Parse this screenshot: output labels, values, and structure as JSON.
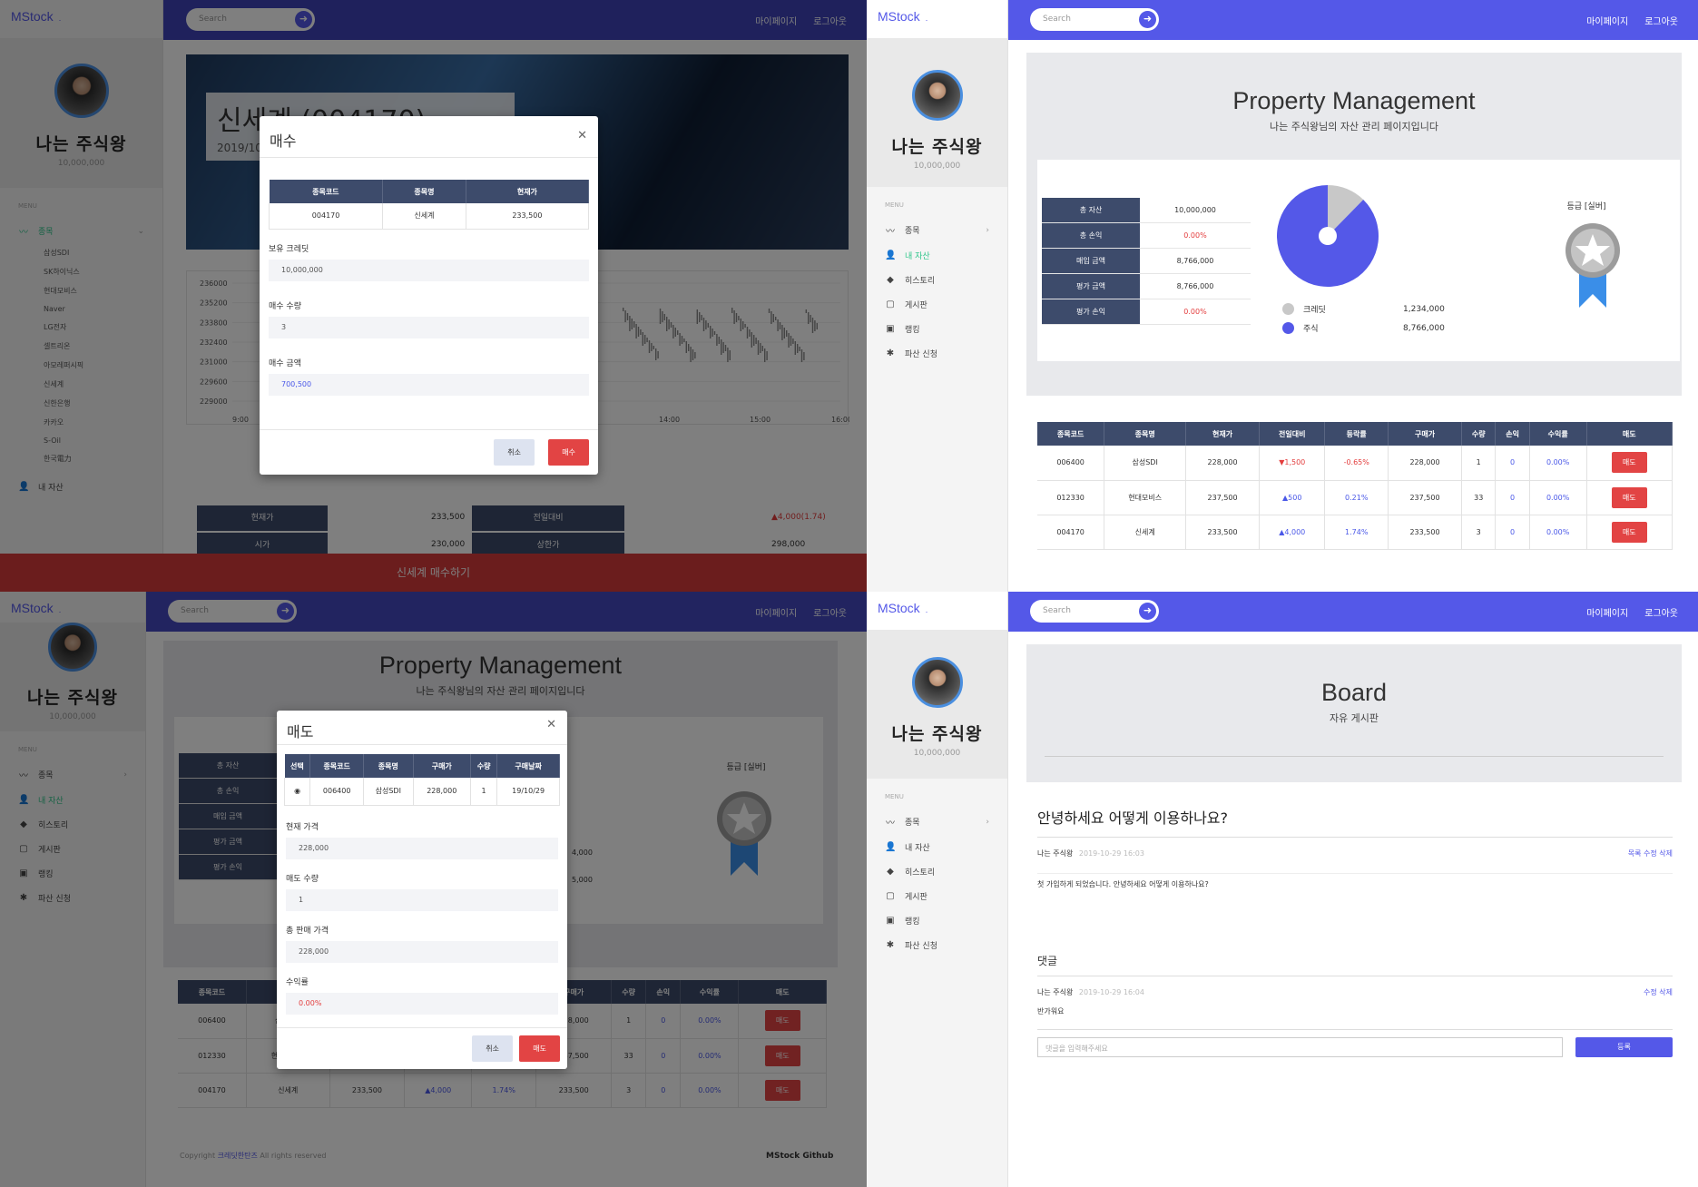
{
  "app": {
    "logo": "MStock",
    "logo_dot": ".",
    "search_placeholder": "Search",
    "nav_mypage": "마이페이지",
    "nav_logout": "로그아웃"
  },
  "profile": {
    "name": "나는 주식왕",
    "balance": "10,000,000"
  },
  "menu": {
    "title": "MENU",
    "items": [
      {
        "label": "종목",
        "icon": "chart-line-icon"
      },
      {
        "label": "내 자산",
        "icon": "user-icon"
      },
      {
        "label": "히스토리",
        "icon": "layers-icon"
      },
      {
        "label": "게시판",
        "icon": "board-icon"
      },
      {
        "label": "랭킹",
        "icon": "book-icon"
      },
      {
        "label": "파산 신청",
        "icon": "asterisk-icon"
      }
    ]
  },
  "stock_list": [
    "삼성SDI",
    "SK하이닉스",
    "현대모비스",
    "Naver",
    "LG전자",
    "셀트리온",
    "아모레퍼시픽",
    "신세계",
    "신한은행",
    "카카오",
    "S-Oil",
    "한국電力"
  ],
  "q1": {
    "banner_title": "신세계 (004170)",
    "banner_date": "2019/10",
    "y_ticks": [
      "236000",
      "235200",
      "233800",
      "232400",
      "231000",
      "229600",
      "229000"
    ],
    "x_ticks": [
      "9:00",
      "14:00",
      "15:00",
      "16:00"
    ],
    "info": [
      {
        "k": "현재가",
        "v": "233,500"
      },
      {
        "k": "전일대비",
        "v": "▲4,000(1.74)"
      },
      {
        "k": "시가",
        "v": "230,000"
      },
      {
        "k": "상한가",
        "v": "298,000"
      }
    ],
    "buy_bar": "신세계 매수하기",
    "modal": {
      "title": "매수",
      "headers": [
        "종목코드",
        "종목명",
        "현재가"
      ],
      "row": [
        "004170",
        "신세계",
        "233,500"
      ],
      "credit_label": "보유 크레딧",
      "credit_value": "10,000,000",
      "qty_label": "매수 수량",
      "qty_value": "3",
      "amount_label": "매수 금액",
      "amount_value": "700,500",
      "cancel": "취소",
      "confirm": "매수"
    }
  },
  "property": {
    "title": "Property Management",
    "subtitle": "나는 주식왕님의 자산 관리 페이지입니다",
    "summary": [
      {
        "k": "총 자산",
        "v": "10,000,000"
      },
      {
        "k": "총 손익",
        "v": "0.00%"
      },
      {
        "k": "매입 금액",
        "v": "8,766,000"
      },
      {
        "k": "평가 금액",
        "v": "8,766,000"
      },
      {
        "k": "평가 손익",
        "v": "0.00%"
      }
    ],
    "grade_label": "등급 [실버]"
  },
  "chart_data": {
    "type": "pie",
    "categories": [
      "크레딧",
      "주식"
    ],
    "values": [
      1234000,
      8766000
    ],
    "labels": [
      "1,234,000",
      "8,766,000"
    ],
    "colors": [
      "#c8c8c8",
      "#5458e8"
    ]
  },
  "holdings": {
    "headers": [
      "종목코드",
      "종목명",
      "현재가",
      "전일대비",
      "등락률",
      "구매가",
      "수량",
      "손익",
      "수익률",
      "매도"
    ],
    "rows": [
      {
        "code": "006400",
        "name": "삼성SDI",
        "price": "228,000",
        "change": "▼1,500",
        "rate": "-0.65%",
        "buy": "228,000",
        "qty": "1",
        "pl": "0",
        "ret": "0.00%",
        "btn": "매도"
      },
      {
        "code": "012330",
        "name": "현대모비스",
        "price": "237,500",
        "change": "▲500",
        "rate": "0.21%",
        "buy": "237,500",
        "qty": "33",
        "pl": "0",
        "ret": "0.00%",
        "btn": "매도"
      },
      {
        "code": "004170",
        "name": "신세계",
        "price": "233,500",
        "change": "▲4,000",
        "rate": "1.74%",
        "buy": "233,500",
        "qty": "3",
        "pl": "0",
        "ret": "0.00%",
        "btn": "매도"
      }
    ]
  },
  "q3": {
    "partial_values": [
      "4,000",
      "5,000"
    ],
    "modal": {
      "title": "매도",
      "headers": [
        "선택",
        "종목코드",
        "종목명",
        "구매가",
        "수량",
        "구매날짜"
      ],
      "row": [
        "◉",
        "006400",
        "삼성SDI",
        "228,000",
        "1",
        "19/10/29"
      ],
      "price_label": "현재 가격",
      "price_value": "228,000",
      "qty_label": "매도 수량",
      "qty_value": "1",
      "total_label": "총 판매 가격",
      "total_value": "228,000",
      "ret_label": "수익률",
      "ret_value": "0.00%",
      "cancel": "취소",
      "confirm": "매도"
    },
    "footer_copy": "Copyright",
    "footer_brand": "크레딧한탄즈",
    "footer_rights": "All rights reserved",
    "footer_github": "MStock Github"
  },
  "board": {
    "title": "Board",
    "subtitle": "자유 게시판",
    "post_title": "안녕하세요 어떻게 이용하나요?",
    "author": "나는 주식왕",
    "post_date": "2019-10-29 16:03",
    "post_actions": "목록 수정 삭제",
    "body": "첫 가입하게 되었습니다. 안녕하세요 어떻게 이용하나요?",
    "comments_title": "댓글",
    "c_author": "나는 주식왕",
    "c_date": "2019-10-29 16:04",
    "c_actions": "수정 삭제",
    "c_body": "반가워요",
    "input_placeholder": "댓글을 입력해주세요",
    "submit": "등록"
  }
}
